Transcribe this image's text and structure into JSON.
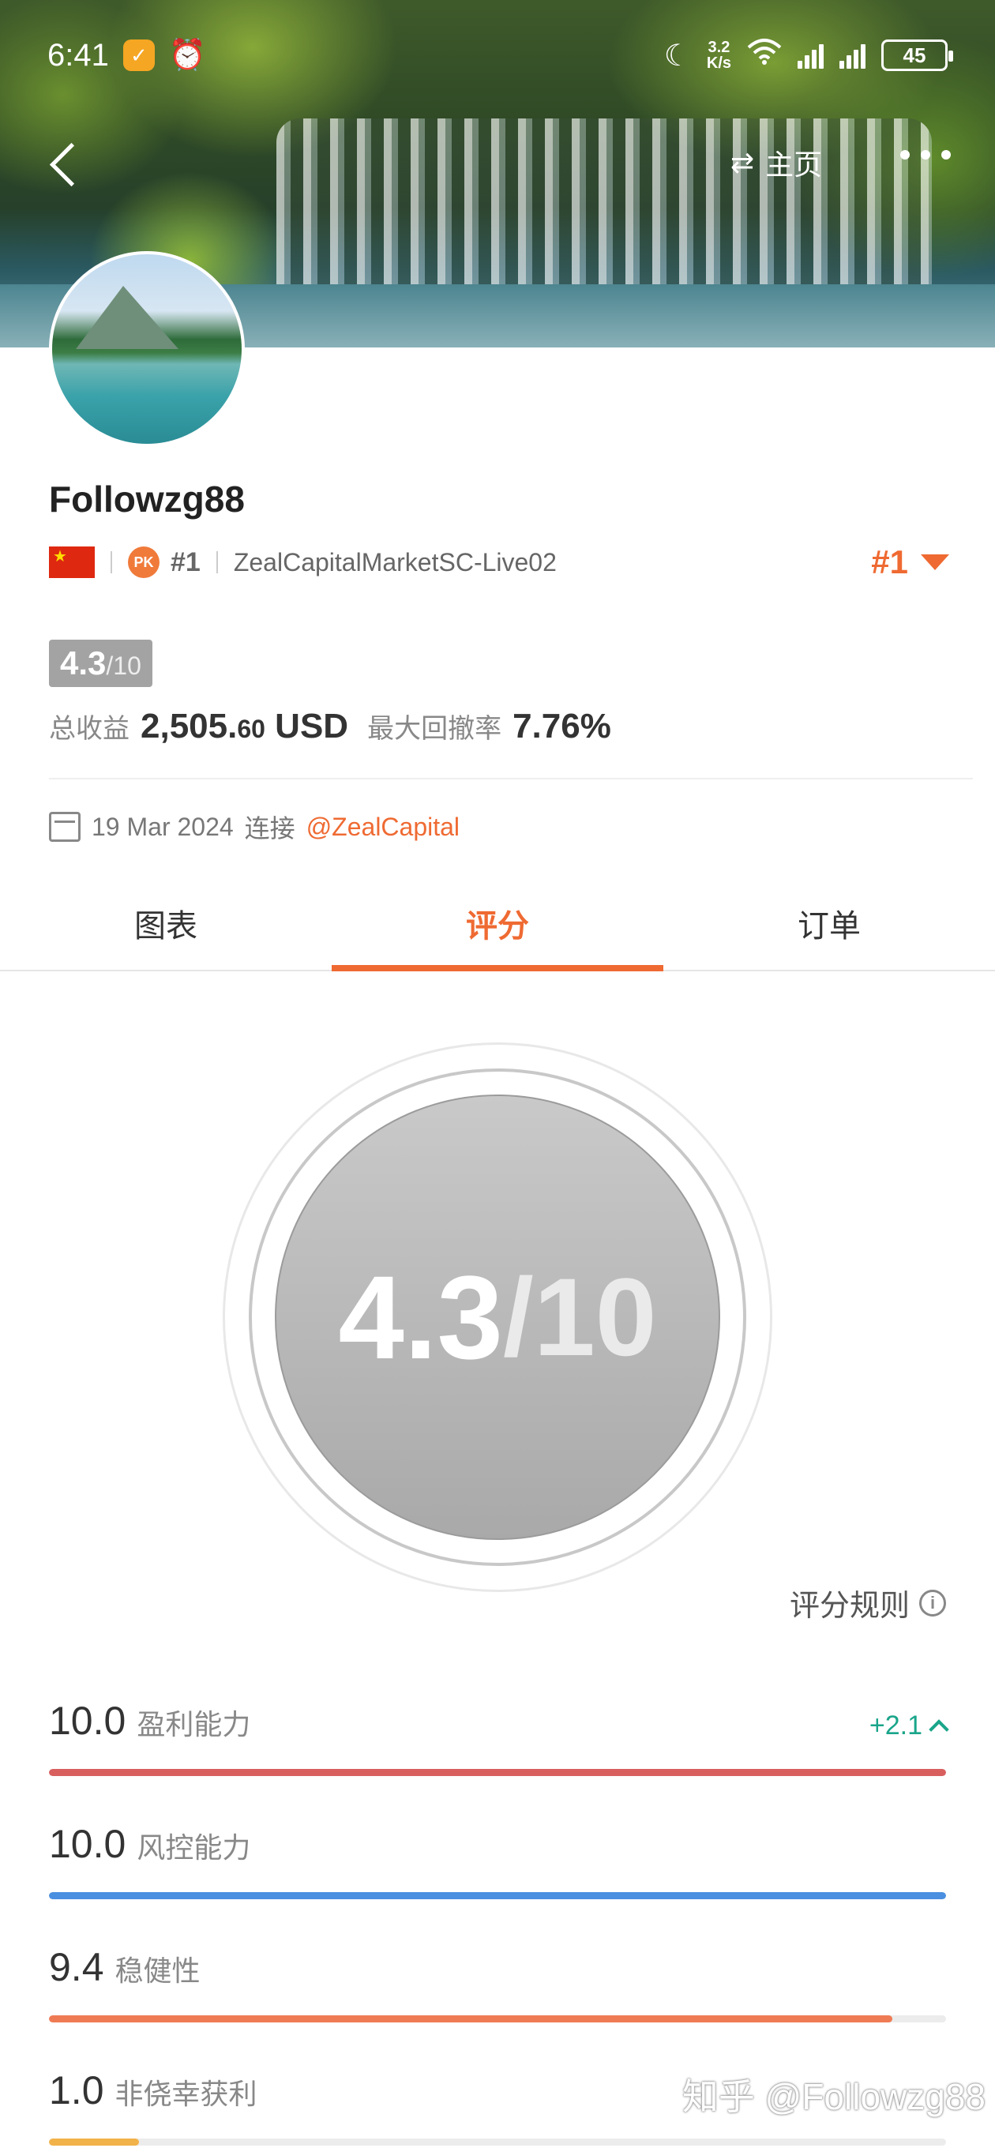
{
  "status": {
    "time": "6:41",
    "netspeed_top": "3.2",
    "netspeed_bottom": "K/s",
    "battery": "45"
  },
  "nav": {
    "home_label": "主页"
  },
  "profile": {
    "username": "Followzg88",
    "pk_rank": "#1",
    "pk_badge": "PK",
    "account": "ZealCapitalMarketSC-Live02",
    "rank_right": "#1"
  },
  "score_badge": {
    "value": "4.3",
    "total": "/10"
  },
  "income": {
    "label": "总收益",
    "amount_main": "2,505.",
    "amount_cents": "60",
    "currency": "USD",
    "drawdown_label": "最大回撤率",
    "drawdown_value": "7.76%"
  },
  "join": {
    "date": "19 Mar 2024",
    "label": "连接",
    "link": "@ZealCapital"
  },
  "tabs": [
    {
      "label": "图表",
      "active": false
    },
    {
      "label": "评分",
      "active": true
    },
    {
      "label": "订单",
      "active": false
    }
  ],
  "score_circle": {
    "value": "4.3",
    "total": "/10"
  },
  "rules_label": "评分规则",
  "metrics": [
    {
      "value": "10.0",
      "label": "盈利能力",
      "delta": "+2.1",
      "fraction": 1.0,
      "color": "#d95f5f"
    },
    {
      "value": "10.0",
      "label": "风控能力",
      "delta": "",
      "fraction": 1.0,
      "color": "#4a8fe0"
    },
    {
      "value": "9.4",
      "label": "稳健性",
      "delta": "",
      "fraction": 0.94,
      "color": "#ef7b54"
    },
    {
      "value": "1.0",
      "label": "非侥幸获利",
      "delta": "",
      "fraction": 0.1,
      "color": "#f2b24a"
    }
  ],
  "watermark": "知乎 @Followzg88"
}
